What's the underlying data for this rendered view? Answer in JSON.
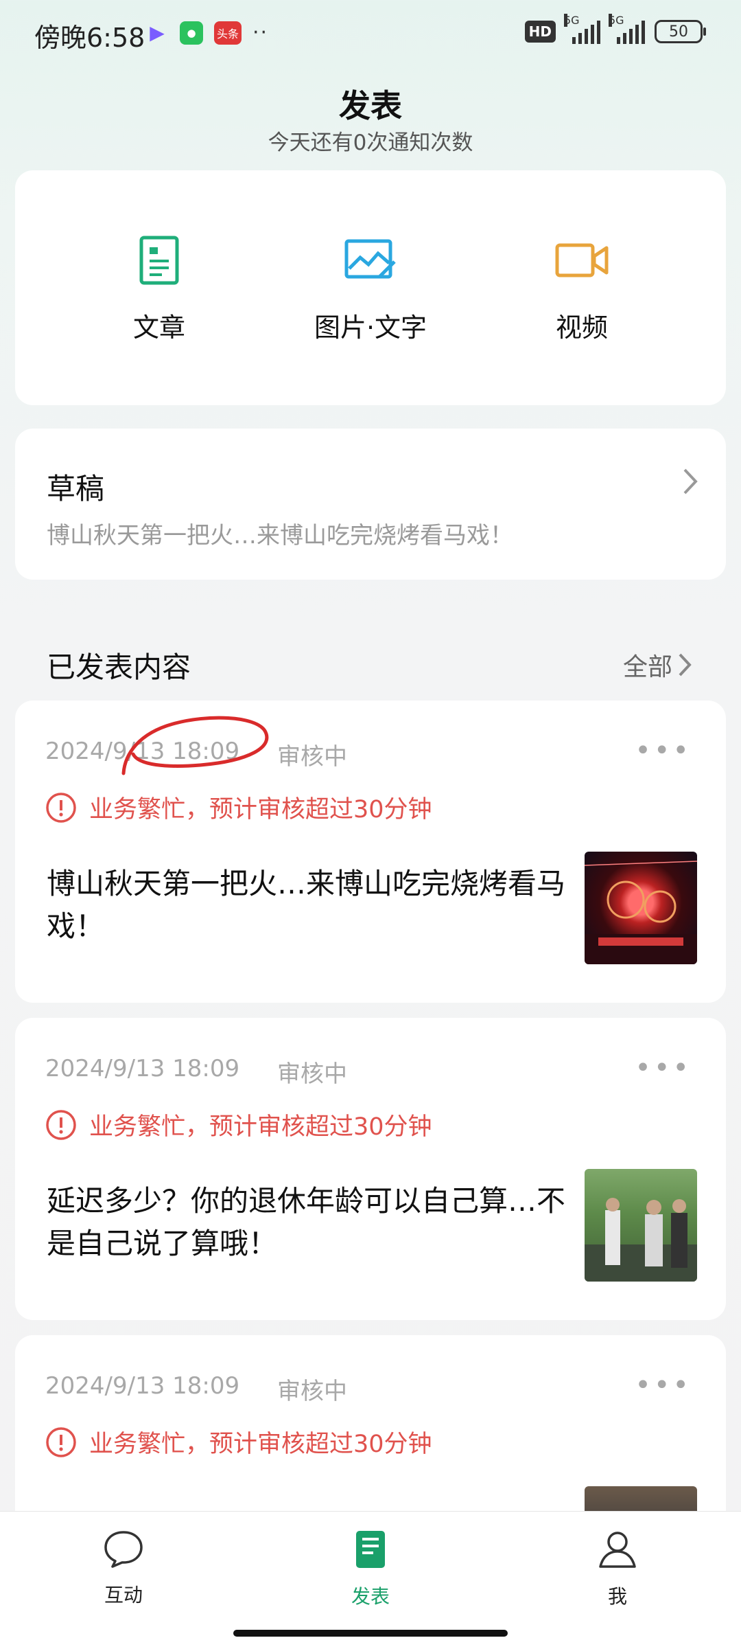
{
  "status_bar": {
    "time": "傍晚6:58",
    "app_icons": [
      "play-icon",
      "wechat-icon",
      "toutiao-icon"
    ],
    "toutiao_label": "头条",
    "dots": "··",
    "hd_label": "HD",
    "signal1_label": "5G",
    "signal2_label": "5G",
    "battery": "50"
  },
  "header": {
    "title": "发表",
    "subtitle": "今天还有0次通知次数"
  },
  "publish": {
    "items": [
      {
        "label": "文章",
        "icon": "article-icon",
        "color": "#1fae7a"
      },
      {
        "label": "图片·文字",
        "icon": "image-text-icon",
        "color": "#2aa7e0"
      },
      {
        "label": "视频",
        "icon": "video-icon",
        "color": "#e8a43c"
      }
    ]
  },
  "draft": {
    "title": "草稿",
    "preview": "博山秋天第一把火…来博山吃完烧烤看马戏！"
  },
  "published": {
    "section_title": "已发表内容",
    "all_label": "全部",
    "posts": [
      {
        "date": "2024/9/13 18:09",
        "status": "审核中",
        "warning": "业务繁忙，预计审核超过30分钟",
        "title": "博山秋天第一把火…来博山吃完烧烤看马戏！"
      },
      {
        "date": "2024/9/13 18:09",
        "status": "审核中",
        "warning": "业务繁忙，预计审核超过30分钟",
        "title": "延迟多少？你的退休年龄可以自己算…不是自己说了算哦！"
      },
      {
        "date": "2024/9/13 18:09",
        "status": "审核中",
        "warning": "业务繁忙，预计审核超过30分钟",
        "title": ""
      }
    ]
  },
  "bottom_nav": {
    "tabs": [
      {
        "label": "互动",
        "icon": "chat-bubble-icon"
      },
      {
        "label": "发表",
        "icon": "publish-doc-icon",
        "active": true
      },
      {
        "label": "我",
        "icon": "user-icon"
      }
    ]
  },
  "colors": {
    "accent": "#1aa06a",
    "warning": "#e0524d",
    "annotation": "#d92b2b"
  }
}
